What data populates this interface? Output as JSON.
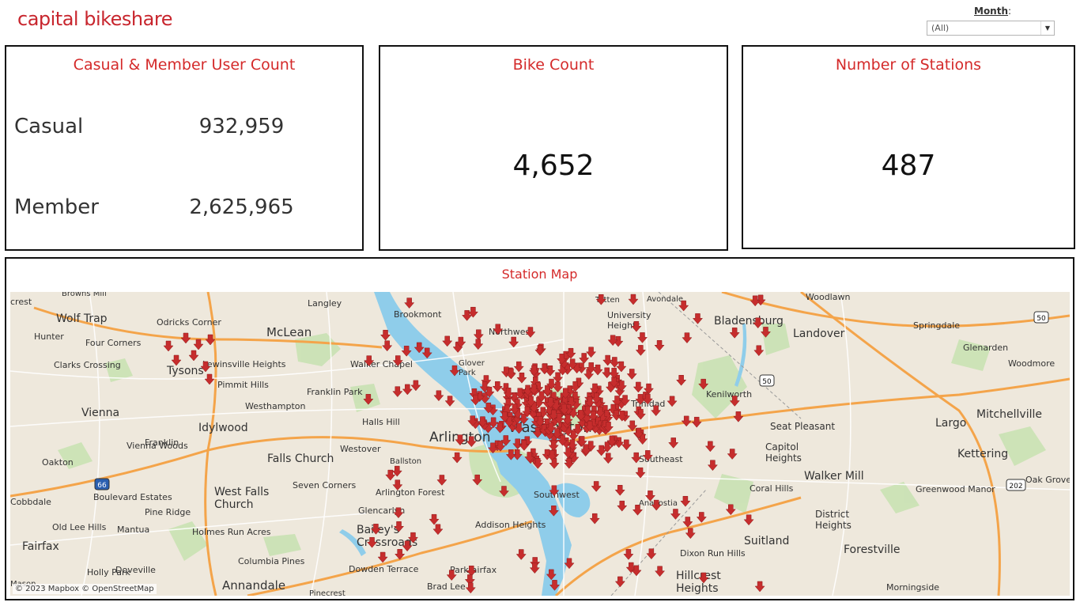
{
  "header": {
    "logo_text": "capital bikeshare",
    "month_label": "Month",
    "month_value": "(All)"
  },
  "cards": {
    "users": {
      "title": "Casual & Member User Count",
      "casual_label": "Casual",
      "casual_value": "932,959",
      "member_label": "Member",
      "member_value": "2,625,965"
    },
    "bikes": {
      "title": "Bike Count",
      "value": "4,652"
    },
    "stations": {
      "title": "Number of Stations",
      "value": "487"
    }
  },
  "map": {
    "title": "Station Map",
    "attribution": "© 2023 Mapbox © OpenStreetMap",
    "marker_color": "#c62d2d",
    "places": [
      {
        "name": "crest"
      },
      {
        "name": "Browns Mill"
      },
      {
        "name": "Wolf Trap"
      },
      {
        "name": "Odricks Corner"
      },
      {
        "name": "Hunter"
      },
      {
        "name": "Four Corners"
      },
      {
        "name": "Clarks Crossing"
      },
      {
        "name": "Tysons"
      },
      {
        "name": "Lewinsville Heights"
      },
      {
        "name": "Pimmit Hills"
      },
      {
        "name": "McLean"
      },
      {
        "name": "Langley"
      },
      {
        "name": "Brookmont"
      },
      {
        "name": "Walker Chapel"
      },
      {
        "name": "Franklin Park"
      },
      {
        "name": "Westhampton"
      },
      {
        "name": "Vienna"
      },
      {
        "name": "Franklin"
      },
      {
        "name": "Idylwood"
      },
      {
        "name": "Halls Hill"
      },
      {
        "name": "Arlington"
      },
      {
        "name": "Vienna Woods"
      },
      {
        "name": "Oakton"
      },
      {
        "name": "Falls Church"
      },
      {
        "name": "Westover"
      },
      {
        "name": "Ballston"
      },
      {
        "name": "Seven Corners"
      },
      {
        "name": "Arlington Forest"
      },
      {
        "name": "Boulevard Estates"
      },
      {
        "name": "West Falls Church"
      },
      {
        "name": "Cobbdale"
      },
      {
        "name": "Pine Ridge"
      },
      {
        "name": "Glencarlyn"
      },
      {
        "name": "Old Lee Hills"
      },
      {
        "name": "Mantua"
      },
      {
        "name": "Holmes Run Acres"
      },
      {
        "name": "Bailey's Crossroads"
      },
      {
        "name": "Addison Heights"
      },
      {
        "name": "Fairfax"
      },
      {
        "name": "Columbia Pines"
      },
      {
        "name": "Holly Park"
      },
      {
        "name": "Doveville"
      },
      {
        "name": "Dowden Terrace"
      },
      {
        "name": "Parkfairfax"
      },
      {
        "name": "Annandale"
      },
      {
        "name": "Brad Lee"
      },
      {
        "name": "Pinecrest"
      },
      {
        "name": "Mason"
      },
      {
        "name": "Northwest"
      },
      {
        "name": "Glover Park"
      },
      {
        "name": "Totten"
      },
      {
        "name": "Avondale"
      },
      {
        "name": "University Heights"
      },
      {
        "name": "Bladensburg"
      },
      {
        "name": "Woodlawn"
      },
      {
        "name": "Landover"
      },
      {
        "name": "Springdale"
      },
      {
        "name": "Glenarden"
      },
      {
        "name": "Woodmore"
      },
      {
        "name": "Kenilworth"
      },
      {
        "name": "Trinidad"
      },
      {
        "name": "Seat Pleasant"
      },
      {
        "name": "Capitol Heights"
      },
      {
        "name": "Largo"
      },
      {
        "name": "Mitchellville"
      },
      {
        "name": "Kettering"
      },
      {
        "name": "Walker Mill"
      },
      {
        "name": "Coral Hills"
      },
      {
        "name": "Greenwood Manor"
      },
      {
        "name": "Oak Grove"
      },
      {
        "name": "District Heights"
      },
      {
        "name": "Southwest"
      },
      {
        "name": "Anacostia"
      },
      {
        "name": "Suitland"
      },
      {
        "name": "Forestville"
      },
      {
        "name": "Hillcrest Heights"
      },
      {
        "name": "Dixon Run Hills"
      },
      {
        "name": "Morningside"
      },
      {
        "name": "Southeast"
      },
      {
        "name": "Washington"
      }
    ],
    "shields": [
      {
        "label": "66"
      },
      {
        "label": "50"
      },
      {
        "label": "50"
      },
      {
        "label": "202"
      }
    ]
  }
}
